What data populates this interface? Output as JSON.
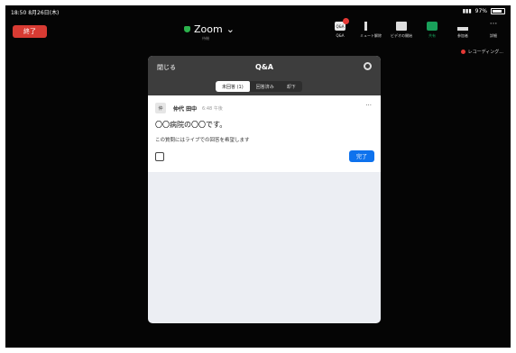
{
  "status": {
    "time": "18:50  8月26日(木)",
    "battery": "97%"
  },
  "header": {
    "end_label": "終了",
    "app_title": "Zoom",
    "app_subtitle": "待機"
  },
  "toolbar": [
    {
      "name": "qa",
      "label": "Q&A",
      "icon_text": "Q&A",
      "has_badge": true
    },
    {
      "name": "mute",
      "label": "ミュート解除"
    },
    {
      "name": "video",
      "label": "ビデオの開始"
    },
    {
      "name": "share",
      "label": "共有"
    },
    {
      "name": "participants",
      "label": "参加者"
    },
    {
      "name": "more",
      "label": "詳細"
    }
  ],
  "recording": {
    "label": "レコーディング..."
  },
  "qa_panel": {
    "close_label": "閉じる",
    "title": "Q&A",
    "tabs": [
      "未回答 (1)",
      "回答済み",
      "却下"
    ],
    "question": {
      "avatar_char": "仲",
      "author": "仲代 田中",
      "time": "6:48 午後",
      "text": "〇〇病院の〇〇です。",
      "live_note": "この質問にはライブでの回答を希望します",
      "done_label": "完了"
    }
  },
  "colors": {
    "end": "#d83b33",
    "accent": "#0e72ed",
    "share": "#19a05a"
  }
}
